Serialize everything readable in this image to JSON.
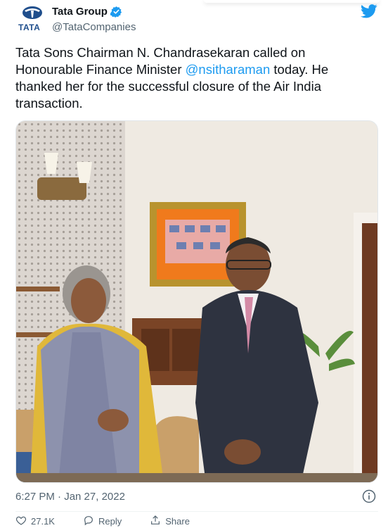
{
  "author": {
    "name": "Tata Group",
    "handle": "@TataCompanies",
    "logo_text": "TATA",
    "verified": true
  },
  "tweet": {
    "text_before": "Tata Sons Chairman N. Chandrasekaran called on Honourable Finance Minister ",
    "mention": "@nsitharaman",
    "text_after": " today. He thanked her for the successful closure of the Air India transaction."
  },
  "photo": {
    "description_icon": "photo"
  },
  "meta": {
    "timestamp": "6:27 PM · Jan 27, 2022"
  },
  "actions": {
    "like_label": "27.1K",
    "reply_label": "Reply",
    "share_label": "Share"
  },
  "colors": {
    "accent": "#1d9bf0",
    "tata_blue": "#1f4e8c",
    "text_primary": "#0f1419",
    "text_secondary": "#536471"
  },
  "icons": [
    "tata-logo-icon",
    "verified-icon",
    "twitter-bird-icon",
    "info-icon",
    "heart-icon",
    "reply-icon",
    "share-icon"
  ]
}
